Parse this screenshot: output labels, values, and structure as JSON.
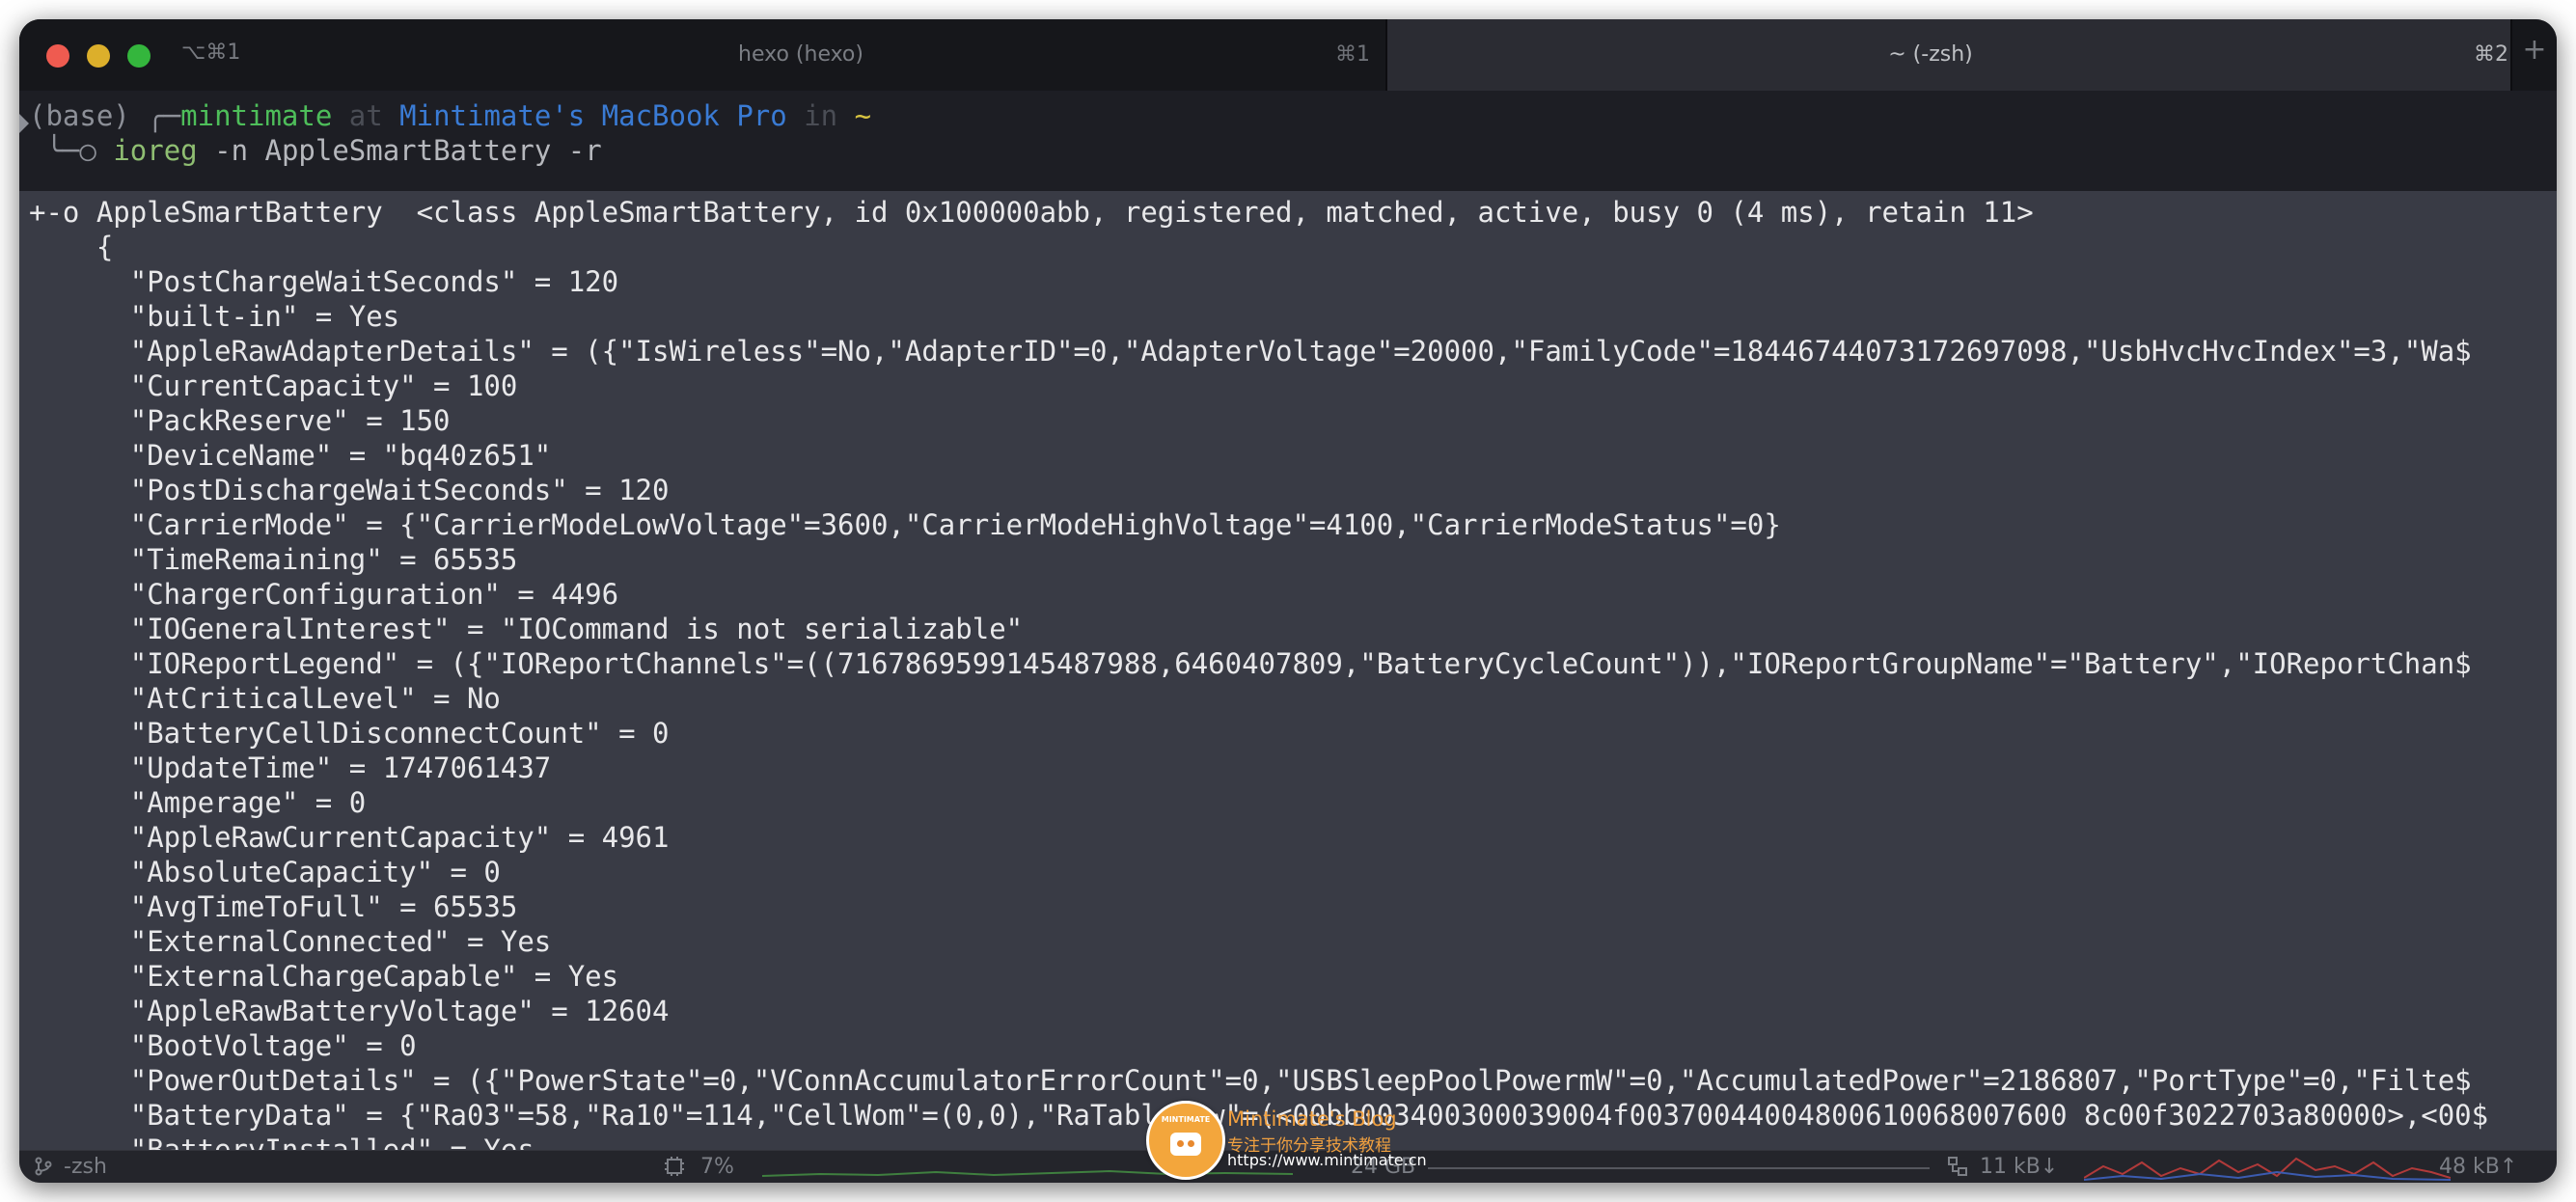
{
  "window": {
    "leading_shortcut": "⌥⌘1",
    "tabs": [
      {
        "title": "hexo (hexo)",
        "shortcut": "⌘1",
        "active": false
      },
      {
        "title": "~ (-zsh)",
        "shortcut": "⌘2",
        "active": true
      }
    ],
    "add_tab": "+"
  },
  "prompt": {
    "env": "(base)",
    "corner_top": "╭─",
    "user": "mintimate",
    "at": "at",
    "host": "Mintimate's MacBook Pro",
    "in": "in",
    "dir": "~",
    "corner_bottom": "╰─○",
    "command": "ioreg",
    "args": "-n AppleSmartBattery -r"
  },
  "output": [
    "+-o AppleSmartBattery  <class AppleSmartBattery, id 0x100000abb, registered, matched, active, busy 0 (4 ms), retain 11>",
    "    {",
    "      \"PostChargeWaitSeconds\" = 120",
    "      \"built-in\" = Yes",
    "      \"AppleRawAdapterDetails\" = ({\"IsWireless\"=No,\"AdapterID\"=0,\"AdapterVoltage\"=20000,\"FamilyCode\"=18446744073172697098,\"UsbHvcHvcIndex\"=3,\"Wa$",
    "      \"CurrentCapacity\" = 100",
    "      \"PackReserve\" = 150",
    "      \"DeviceName\" = \"bq40z651\"",
    "      \"PostDischargeWaitSeconds\" = 120",
    "      \"CarrierMode\" = {\"CarrierModeLowVoltage\"=3600,\"CarrierModeHighVoltage\"=4100,\"CarrierModeStatus\"=0}",
    "      \"TimeRemaining\" = 65535",
    "      \"ChargerConfiguration\" = 4496",
    "      \"IOGeneralInterest\" = \"IOCommand is not serializable\"",
    "      \"IOReportLegend\" = ({\"IOReportChannels\"=((7167869599145487988,6460407809,\"BatteryCycleCount\")),\"IOReportGroupName\"=\"Battery\",\"IOReportChan$",
    "      \"AtCriticalLevel\" = No",
    "      \"BatteryCellDisconnectCount\" = 0",
    "      \"UpdateTime\" = 1747061437",
    "      \"Amperage\" = 0",
    "      \"AppleRawCurrentCapacity\" = 4961",
    "      \"AbsoluteCapacity\" = 0",
    "      \"AvgTimeToFull\" = 65535",
    "      \"ExternalConnected\" = Yes",
    "      \"ExternalChargeCapable\" = Yes",
    "      \"AppleRawBatteryVoltage\" = 12604",
    "      \"BootVoltage\" = 0",
    "      \"PowerOutDetails\" = ({\"PowerState\"=0,\"VConnAccumulatorErrorCount\"=0,\"USBSleepPoolPowermW\"=0,\"AccumulatedPower\"=2186807,\"PortType\"=0,\"Filte$",
    "      \"BatteryData\" = {\"Ra03\"=58,\"Ra10\"=114,\"CellWom\"=(0,0),\"RaTableRaw\"=(<00bb003400300039004f00370044004800610068007600 8c00f3022703a80000>,<00$",
    "      \"BatteryInstalled\" = Yes"
  ],
  "status_bar": {
    "job": "-zsh",
    "cpu": "7%",
    "memory": "24 GB",
    "net_down": "11 kB↓",
    "net_up": "48 kB↑"
  },
  "watermark": {
    "badge": "MINTIMATE",
    "title": "Mintimate's Blog",
    "subtitle": "专注于你分享技术教程",
    "url": "https://www.mintimate.cn"
  },
  "colors": {
    "user": "#4ebe5a",
    "host": "#3a7bd4",
    "dir": "#d8c441",
    "command": "#8fbe72",
    "selection": "#393b45"
  }
}
